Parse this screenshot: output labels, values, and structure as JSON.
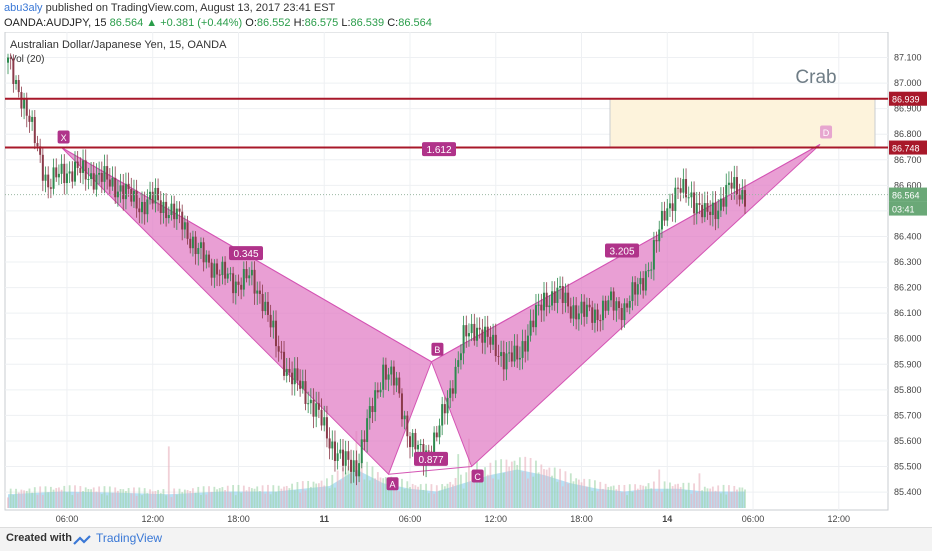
{
  "header": {
    "user": "abu3aly",
    "published": "published on TradingView.com, August 13, 2017 23:41 EST"
  },
  "ohlc": {
    "symbol": "OANDA:AUDJPY, 15",
    "last": "86.564",
    "change_arrow": "▲",
    "change": "+0.381 (+0.44%)",
    "o_label": "O:",
    "o": "86.552",
    "h_label": "H:",
    "h": "86.575",
    "l_label": "L:",
    "l": "86.539",
    "c_label": "C:",
    "c": "86.564"
  },
  "footer": {
    "created_with": "Created with",
    "brand": "TradingView"
  },
  "colors": {
    "pattern_fill": "#e07ac4",
    "pattern_stroke": "#d455b4",
    "label_bg": "#b0338a",
    "level_line": "#a8182a",
    "prz_fill": "#fdf3dc",
    "candle_up": "#2d8a4e",
    "candle_down": "#8b3a4a",
    "volume": "#7ec8ec"
  },
  "chart_data": {
    "type": "candlestick",
    "title": "Australian Dollar/Japanese Yen, 15, OANDA",
    "subtitle": "Vol (20)",
    "ylim": [
      85.33,
      87.2
    ],
    "yticks": [
      "87.100",
      "87.000",
      "86.900",
      "86.800",
      "86.700",
      "86.600",
      "86.500",
      "86.400",
      "86.300",
      "86.200",
      "86.100",
      "86.000",
      "85.900",
      "85.800",
      "85.700",
      "85.600",
      "85.500",
      "85.400"
    ],
    "xticks": [
      "06:00",
      "12:00",
      "18:00",
      "11",
      "06:00",
      "12:00",
      "18:00",
      "14",
      "06:00",
      "12:00"
    ],
    "price_tags": {
      "upper": "86.939",
      "lower": "86.748",
      "last": "86.564",
      "countdown": "03:41"
    },
    "levels": [
      86.939,
      86.748
    ],
    "pattern_name": "Crab",
    "pattern_points": [
      {
        "label": "X",
        "price": 86.748
      },
      {
        "label": "A",
        "price": 85.47
      },
      {
        "label": "B",
        "price": 85.91
      },
      {
        "label": "C",
        "price": 85.5
      },
      {
        "label": "D",
        "price": 86.76
      }
    ],
    "ratios": [
      "0.345",
      "0.877",
      "3.205",
      "1.612"
    ],
    "path": [
      [
        0,
        87.08
      ],
      [
        5,
        86.95
      ],
      [
        10,
        86.78
      ],
      [
        15,
        86.6
      ],
      [
        20,
        86.65
      ],
      [
        25,
        86.66
      ],
      [
        30,
        86.64
      ],
      [
        35,
        86.63
      ],
      [
        40,
        86.6
      ],
      [
        45,
        86.56
      ],
      [
        50,
        86.52
      ],
      [
        55,
        86.55
      ],
      [
        60,
        86.5
      ],
      [
        65,
        86.46
      ],
      [
        70,
        86.35
      ],
      [
        75,
        86.3
      ],
      [
        80,
        86.25
      ],
      [
        85,
        86.22
      ],
      [
        90,
        86.24
      ],
      [
        95,
        86.16
      ],
      [
        100,
        85.98
      ],
      [
        105,
        85.86
      ],
      [
        110,
        85.8
      ],
      [
        115,
        85.72
      ],
      [
        120,
        85.6
      ],
      [
        125,
        85.52
      ],
      [
        130,
        85.5
      ],
      [
        135,
        85.7
      ],
      [
        140,
        85.88
      ],
      [
        145,
        85.82
      ],
      [
        150,
        85.6
      ],
      [
        155,
        85.54
      ],
      [
        160,
        85.62
      ],
      [
        165,
        85.8
      ],
      [
        170,
        86.0
      ],
      [
        175,
        86.05
      ],
      [
        180,
        85.98
      ],
      [
        185,
        85.93
      ],
      [
        190,
        85.92
      ],
      [
        195,
        86.05
      ],
      [
        200,
        86.15
      ],
      [
        205,
        86.18
      ],
      [
        210,
        86.12
      ],
      [
        215,
        86.1
      ],
      [
        220,
        86.1
      ],
      [
        225,
        86.14
      ],
      [
        230,
        86.12
      ],
      [
        235,
        86.2
      ],
      [
        240,
        86.3
      ],
      [
        245,
        86.5
      ],
      [
        250,
        86.58
      ],
      [
        255,
        86.56
      ],
      [
        260,
        86.48
      ],
      [
        265,
        86.52
      ],
      [
        270,
        86.6
      ],
      [
        275,
        86.56
      ]
    ],
    "volume_profile": [
      [
        0,
        0.25
      ],
      [
        20,
        0.3
      ],
      [
        40,
        0.28
      ],
      [
        60,
        0.25
      ],
      [
        80,
        0.3
      ],
      [
        100,
        0.3
      ],
      [
        120,
        0.4
      ],
      [
        130,
        0.7
      ],
      [
        140,
        0.45
      ],
      [
        150,
        0.35
      ],
      [
        160,
        0.3
      ],
      [
        170,
        0.45
      ],
      [
        180,
        0.6
      ],
      [
        190,
        0.7
      ],
      [
        200,
        0.6
      ],
      [
        210,
        0.45
      ],
      [
        220,
        0.35
      ],
      [
        230,
        0.3
      ],
      [
        240,
        0.35
      ],
      [
        250,
        0.35
      ],
      [
        260,
        0.3
      ],
      [
        275,
        0.3
      ]
    ],
    "volume_spikes": [
      [
        60,
        0.8
      ],
      [
        130,
        1.0
      ],
      [
        168,
        0.7
      ],
      [
        172,
        0.9
      ],
      [
        175,
        0.6
      ],
      [
        210,
        0.45
      ],
      [
        243,
        0.5
      ],
      [
        258,
        0.45
      ]
    ],
    "grid": true
  }
}
